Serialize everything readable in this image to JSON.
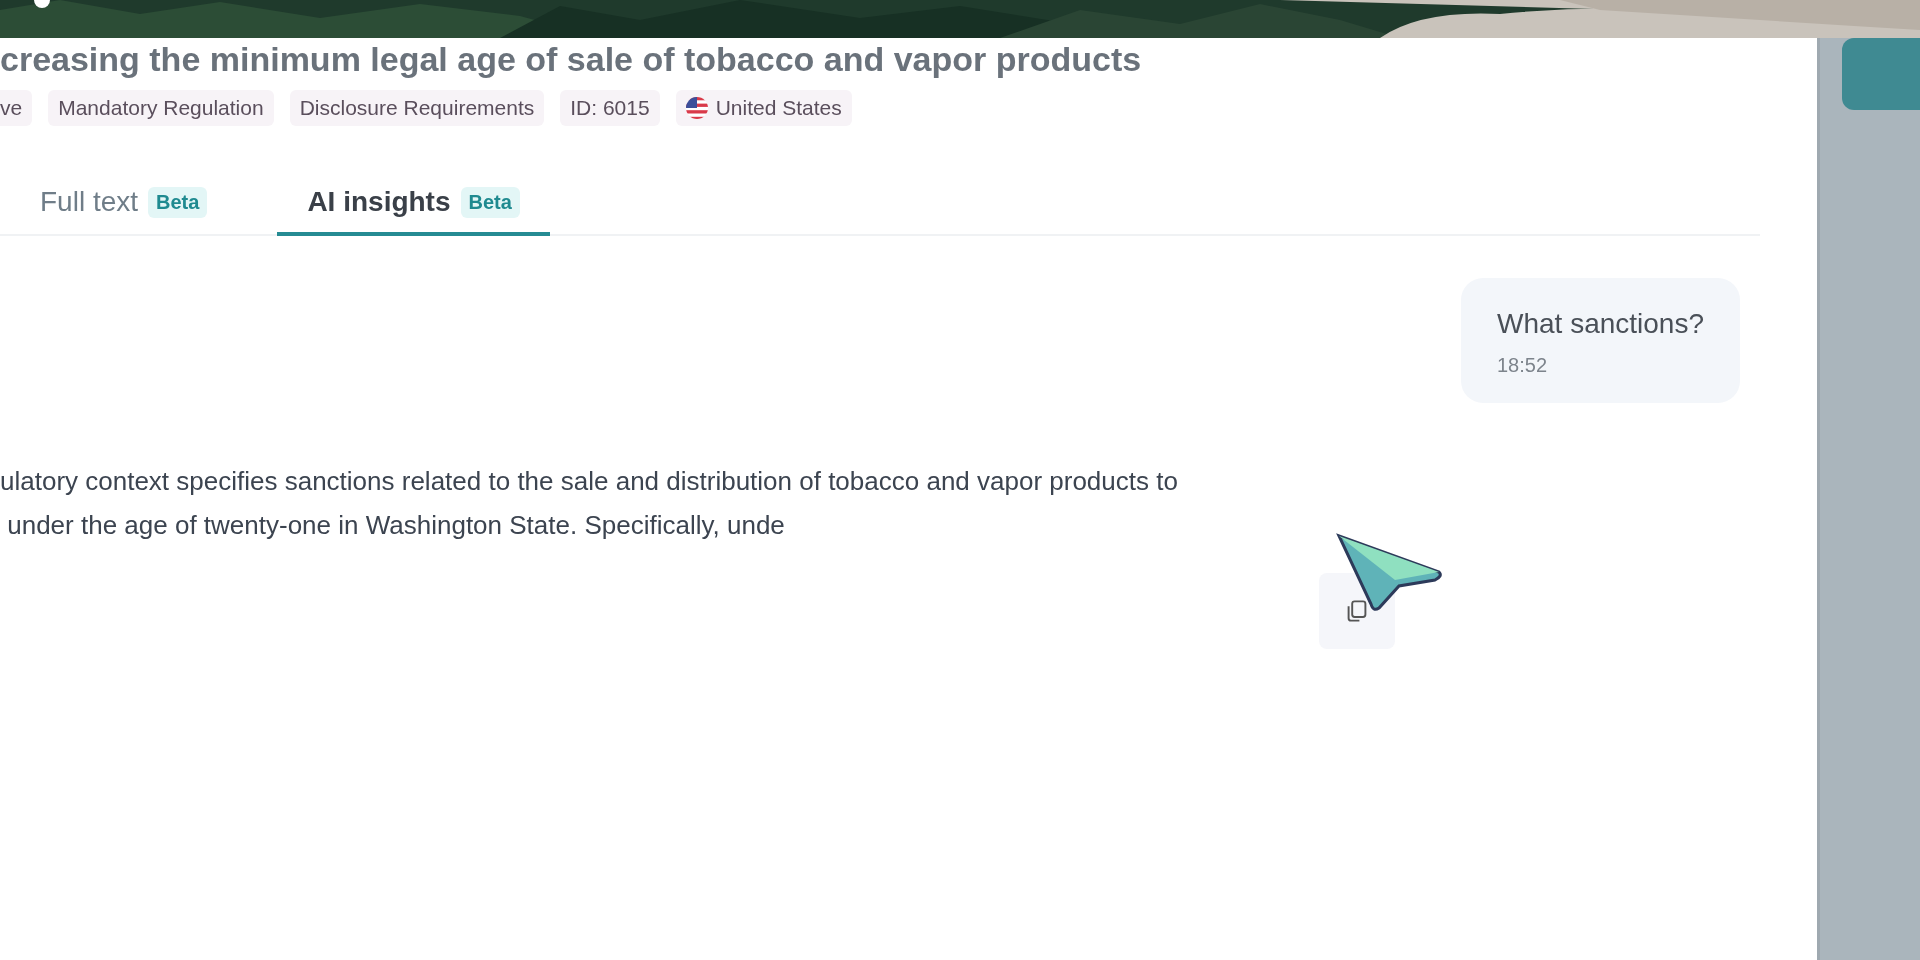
{
  "header": {
    "title": "creasing the minimum legal age of sale of tobacco and vapor products"
  },
  "tags": [
    {
      "kind": "plain",
      "label": "ve"
    },
    {
      "kind": "plain",
      "label": "Mandatory Regulation"
    },
    {
      "kind": "plain",
      "label": "Disclosure Requirements"
    },
    {
      "kind": "plain",
      "label": "ID: 6015"
    },
    {
      "kind": "country",
      "label": "United States"
    }
  ],
  "tabs": [
    {
      "label": "Full text",
      "badge": "Beta",
      "selected": false
    },
    {
      "label": "AI insights",
      "badge": "Beta",
      "selected": true
    }
  ],
  "chat": {
    "question": {
      "text": "What sanctions?",
      "time": "18:52"
    },
    "answer": {
      "lines": [
        "ulatory context specifies sanctions related to the sale and distribution of tobacco and vapor products to",
        " under the age of twenty-one in Washington State. Specifically, unde"
      ]
    }
  }
}
